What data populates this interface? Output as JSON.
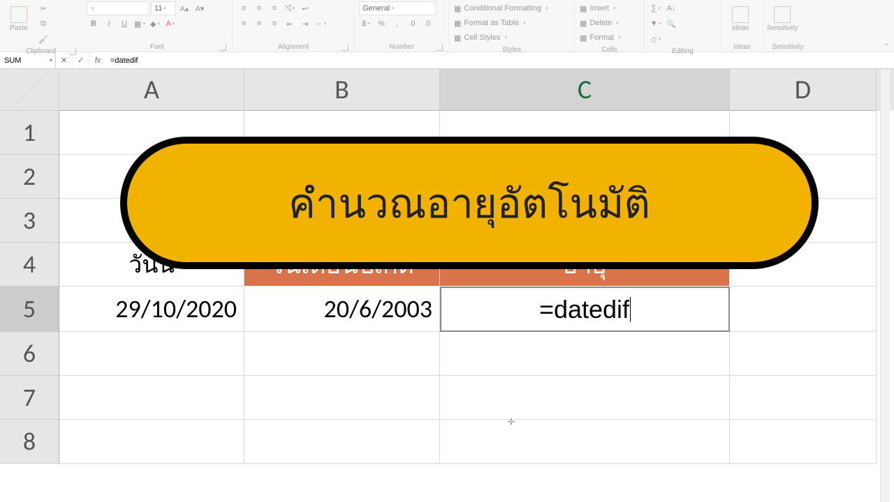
{
  "ribbon": {
    "groups": {
      "clipboard": "Clipboard",
      "font": "Font",
      "alignment": "Alignment",
      "number": "Number",
      "styles": "Styles",
      "cells": "Cells",
      "editing": "Editing",
      "ideas": "Ideas",
      "sensitivity": "Sensitivity",
      "paste": "Paste",
      "numfmt": "General",
      "condfmt": "Conditional Formatting",
      "fmttable": "Format as Table",
      "cellstyles": "Cell Styles",
      "insert": "Insert",
      "delete": "Delete",
      "format": "Format",
      "ideasbtn": "Ideas",
      "sens": "Sensitivity"
    },
    "fontsize": "11"
  },
  "formulaBar": {
    "name": "SUM",
    "formula": "=datedif"
  },
  "cols": {
    "A": "A",
    "B": "B",
    "C": "C",
    "D": "D"
  },
  "rownum": {
    "r1": "1",
    "r2": "2",
    "r3": "3",
    "r4": "4",
    "r5": "5",
    "r6": "6",
    "r7": "7",
    "r8": "8"
  },
  "banner": "คำนวณอายุอัตโนมัติ",
  "headers": {
    "today": "วันนี้",
    "dob": "วันเดือนปีเกิด",
    "age": "อายุ"
  },
  "values": {
    "today": "29/10/2020",
    "dob": "20/6/2003",
    "age": "=datedif"
  },
  "cursor": "✢"
}
